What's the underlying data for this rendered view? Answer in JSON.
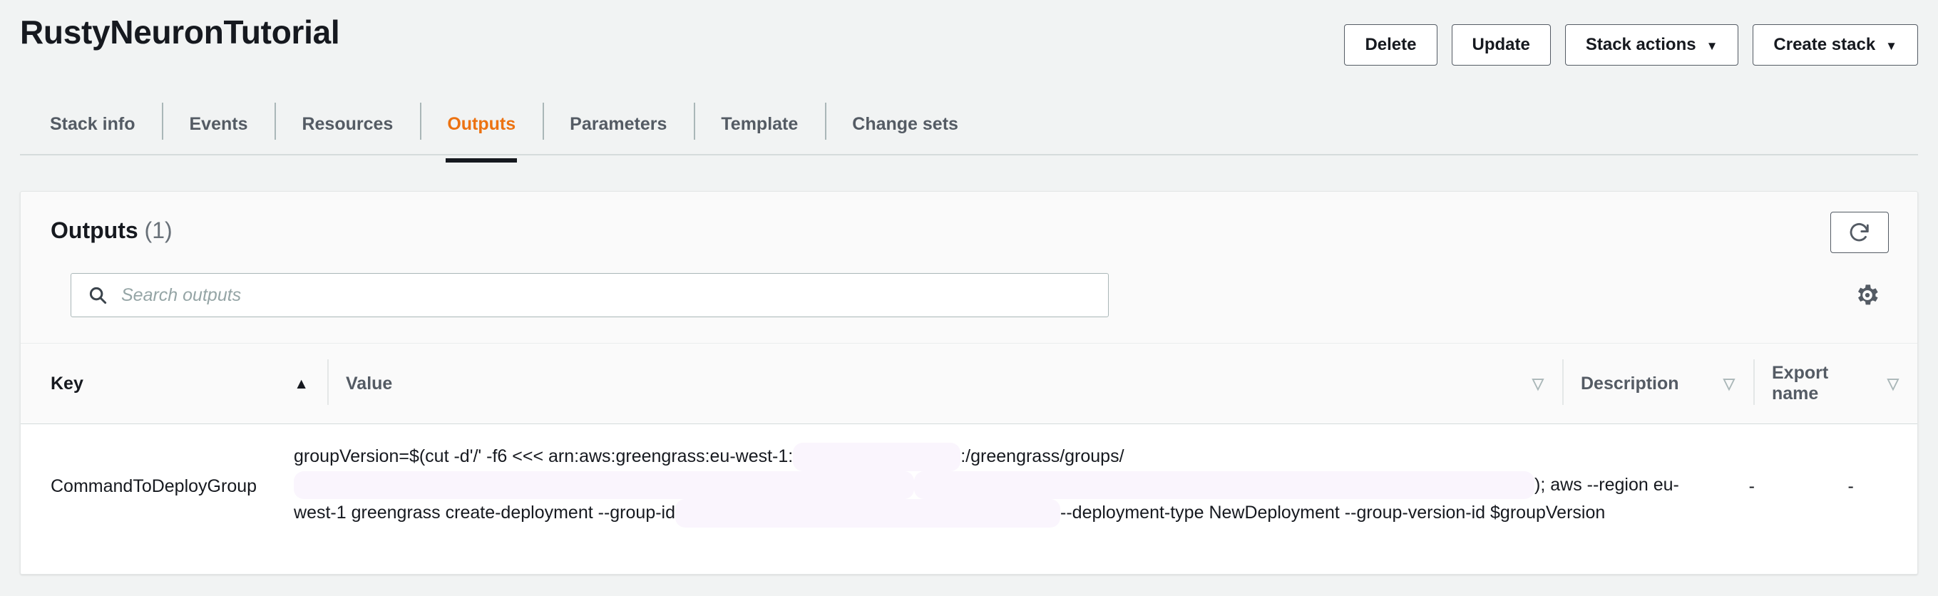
{
  "header": {
    "stack_title": "RustyNeuronTutorial",
    "buttons": [
      {
        "label": "Delete",
        "caret": ""
      },
      {
        "label": "Update",
        "caret": ""
      },
      {
        "label": "Stack actions",
        "caret": "▼"
      },
      {
        "label": "Create stack",
        "caret": "▼"
      }
    ]
  },
  "tabs": [
    {
      "label": "Stack info",
      "active": false
    },
    {
      "label": "Events",
      "active": false
    },
    {
      "label": "Resources",
      "active": false
    },
    {
      "label": "Outputs",
      "active": true
    },
    {
      "label": "Parameters",
      "active": false
    },
    {
      "label": "Template",
      "active": false
    },
    {
      "label": "Change sets",
      "active": false
    }
  ],
  "panel": {
    "title": "Outputs",
    "count": "(1)",
    "refresh_icon": "refresh-icon",
    "settings_icon": "gear-icon"
  },
  "search": {
    "icon": "search-icon",
    "placeholder": "Search outputs",
    "value": ""
  },
  "table": {
    "columns": [
      {
        "label": "Key",
        "sort_icon": "▲",
        "sorted": true
      },
      {
        "label": "Value",
        "sort_icon": "▽",
        "sorted": false
      },
      {
        "label": "Description",
        "sort_icon": "▽",
        "sorted": false
      },
      {
        "label": "Export name",
        "sort_icon": "▽",
        "sorted": false
      }
    ],
    "rows": [
      {
        "key": "CommandToDeployGroup",
        "value_segments": [
          {
            "type": "text",
            "text": "groupVersion=$(cut -d'/' -f6 <<< arn:aws:greengrass:eu-west-1:"
          },
          {
            "type": "redacted",
            "width": "r1"
          },
          {
            "type": "text",
            "text": ":/greengrass/groups/"
          },
          {
            "type": "redacted",
            "width": "r3"
          },
          {
            "type": "redacted",
            "width": "r3"
          },
          {
            "type": "text",
            "text": "); aws --region eu-west-1 greengrass create-deployment --group-id"
          },
          {
            "type": "redacted",
            "width": "r2"
          },
          {
            "type": "text",
            "text": "--deployment-type NewDeployment --group-version-id $groupVersion"
          }
        ],
        "description": "-",
        "export_name": "-"
      }
    ]
  },
  "colors": {
    "page_background": "#f1f3f3",
    "panel_background": "#fafafa",
    "row_background": "#ffffff",
    "accent_orange": "#ec7211",
    "text_primary": "#16191f",
    "text_secondary": "#545b64",
    "border": "#d5dbdb",
    "redaction": "#faf5fd"
  }
}
